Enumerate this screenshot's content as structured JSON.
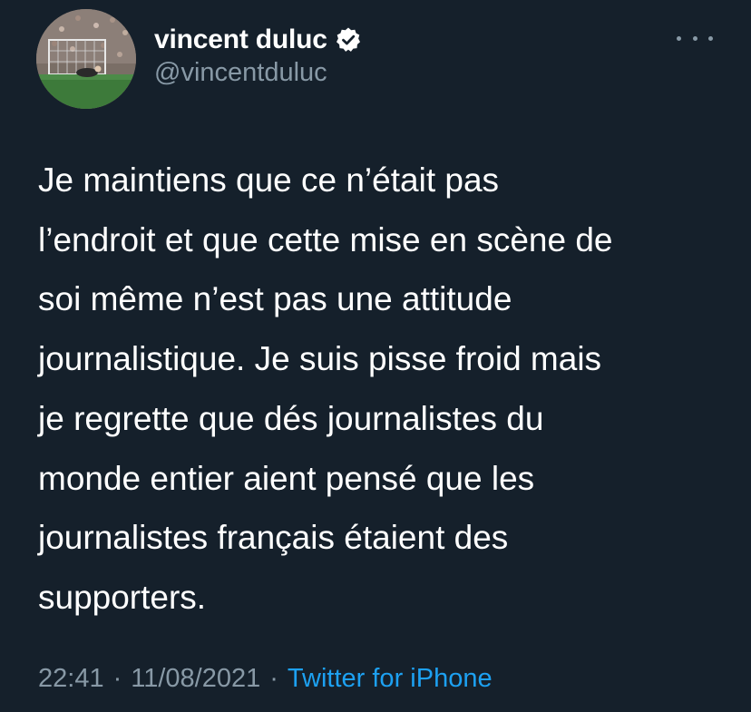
{
  "author": {
    "display_name": "vincent duluc",
    "handle": "@vincentduluc",
    "verified": true,
    "avatar_icon": "soccer-goalkeeper-photo"
  },
  "tweet": {
    "text_lines": [
      "Je maintiens que ce n’était pas",
      "l’endroit et que cette mise en scène de",
      "soi même n’est pas une attitude",
      "journalistique. Je suis pisse froid mais",
      "je regrette que dés journalistes du",
      "monde entier aient pensé que les",
      "journalistes français étaient des",
      "supporters."
    ],
    "time": "22:41",
    "separator": "·",
    "date": "11/08/2021",
    "source": "Twitter for iPhone"
  },
  "icons": {
    "verified": "verified-badge-icon",
    "more": "more-options-icon"
  },
  "colors": {
    "background": "#15202b",
    "text": "#ffffff",
    "muted": "#8899a6",
    "accent": "#1da1f2"
  }
}
